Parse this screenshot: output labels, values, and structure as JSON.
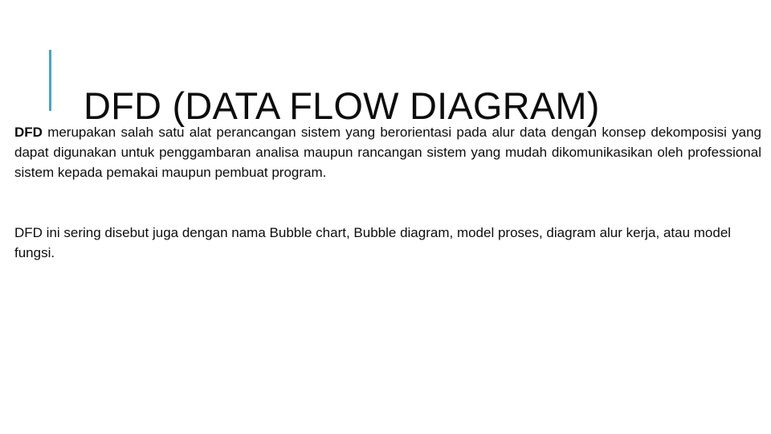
{
  "slide": {
    "title": "DFD (DATA FLOW DIAGRAM)",
    "accent_color": "#45a5ca",
    "background_color": "#ffffff",
    "text_color": "#0d0d0d"
  },
  "body": {
    "paragraph1": {
      "lead": "DFD",
      "rest": " merupakan salah satu alat perancangan sistem yang berorientasi pada alur data dengan konsep dekomposisi yang dapat digunakan untuk penggambaran analisa maupun rancangan sistem yang mudah dikomunikasikan oleh professional sistem kepada pemakai maupun pembuat program."
    },
    "paragraph2": {
      "text": "DFD ini sering disebut juga dengan nama Bubble chart, Bubble diagram, model proses, diagram alur kerja, atau model fungsi."
    }
  }
}
